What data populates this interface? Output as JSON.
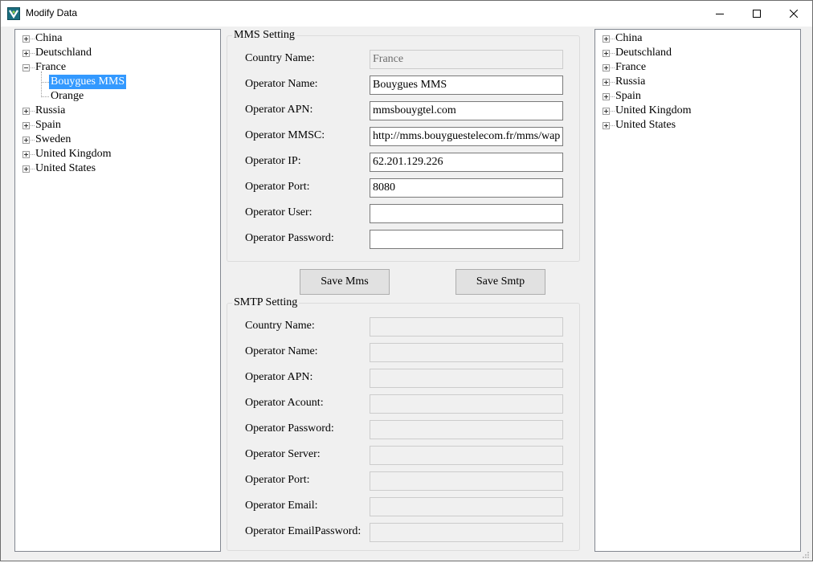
{
  "window": {
    "title": "Modify Data"
  },
  "left_tree": {
    "nodes": [
      {
        "label": "China",
        "expander": "plus"
      },
      {
        "label": "Deutschland",
        "expander": "plus"
      },
      {
        "label": "France",
        "expander": "minus"
      },
      {
        "label": "Bouygues MMS",
        "child": true,
        "selected": true
      },
      {
        "label": "Orange",
        "child": true
      },
      {
        "label": "Russia",
        "expander": "plus"
      },
      {
        "label": "Spain",
        "expander": "plus"
      },
      {
        "label": "Sweden",
        "expander": "plus"
      },
      {
        "label": "United Kingdom",
        "expander": "plus"
      },
      {
        "label": "United States",
        "expander": "plus"
      }
    ]
  },
  "right_tree": {
    "nodes": [
      {
        "label": "China",
        "expander": "plus"
      },
      {
        "label": "Deutschland",
        "expander": "plus"
      },
      {
        "label": "France",
        "expander": "plus"
      },
      {
        "label": "Russia",
        "expander": "plus"
      },
      {
        "label": "Spain",
        "expander": "plus"
      },
      {
        "label": "United Kingdom",
        "expander": "plus"
      },
      {
        "label": "United States",
        "expander": "plus"
      }
    ]
  },
  "mms": {
    "title": "MMS Setting",
    "fields": [
      {
        "label": "Country Name:",
        "value": "France",
        "disabled": true
      },
      {
        "label": "Operator Name:",
        "value": "Bouygues MMS"
      },
      {
        "label": "Operator APN:",
        "value": "mmsbouygtel.com"
      },
      {
        "label": "Operator MMSC:",
        "value": "http://mms.bouyguestelecom.fr/mms/wap"
      },
      {
        "label": "Operator IP:",
        "value": "62.201.129.226"
      },
      {
        "label": "Operator Port:",
        "value": "8080"
      },
      {
        "label": "Operator User:",
        "value": ""
      },
      {
        "label": "Operator Password:",
        "value": ""
      }
    ]
  },
  "buttons": {
    "save_mms": "Save Mms",
    "save_smtp": "Save Smtp"
  },
  "smtp": {
    "title": "SMTP Setting",
    "fields": [
      {
        "label": "Country Name:",
        "value": "",
        "disabled": true
      },
      {
        "label": "Operator Name:",
        "value": "",
        "disabled": true
      },
      {
        "label": "Operator APN:",
        "value": "",
        "disabled": true
      },
      {
        "label": "Operator Acount:",
        "value": "",
        "disabled": true
      },
      {
        "label": "Operator Password:",
        "value": "",
        "disabled": true
      },
      {
        "label": "Operator Server:",
        "value": "",
        "disabled": true
      },
      {
        "label": "Operator Port:",
        "value": "",
        "disabled": true
      },
      {
        "label": "Operator Email:",
        "value": "",
        "disabled": true
      },
      {
        "label": "Operator EmailPassword:",
        "value": "",
        "disabled": true
      }
    ]
  },
  "colors": {
    "selection": "#3399ff",
    "window_bg": "#f0f0f0",
    "disabled_text": "#6d6d6d"
  },
  "icons": [
    "app-logo-icon",
    "minimize-icon",
    "maximize-icon",
    "close-icon",
    "resize-grip-icon"
  ]
}
